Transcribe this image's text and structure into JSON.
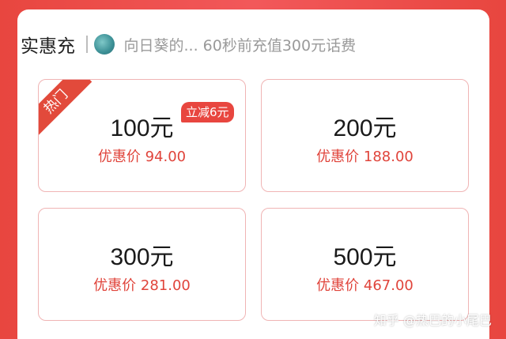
{
  "header": {
    "title": "实惠充",
    "ticker_text": "向日葵的... 60秒前充值300元话费"
  },
  "cards": [
    {
      "amount": "100元",
      "price": "优惠价 94.00",
      "ribbon": "热门",
      "discount": "立减6元"
    },
    {
      "amount": "200元",
      "price": "优惠价 188.00"
    },
    {
      "amount": "300元",
      "price": "优惠价 281.00"
    },
    {
      "amount": "500元",
      "price": "优惠价 467.00"
    }
  ],
  "watermark": "知乎 @热巴的小尾巴",
  "colors": {
    "accent": "#e8463f",
    "price": "#e0443b",
    "card_border": "#f0b4b4"
  }
}
